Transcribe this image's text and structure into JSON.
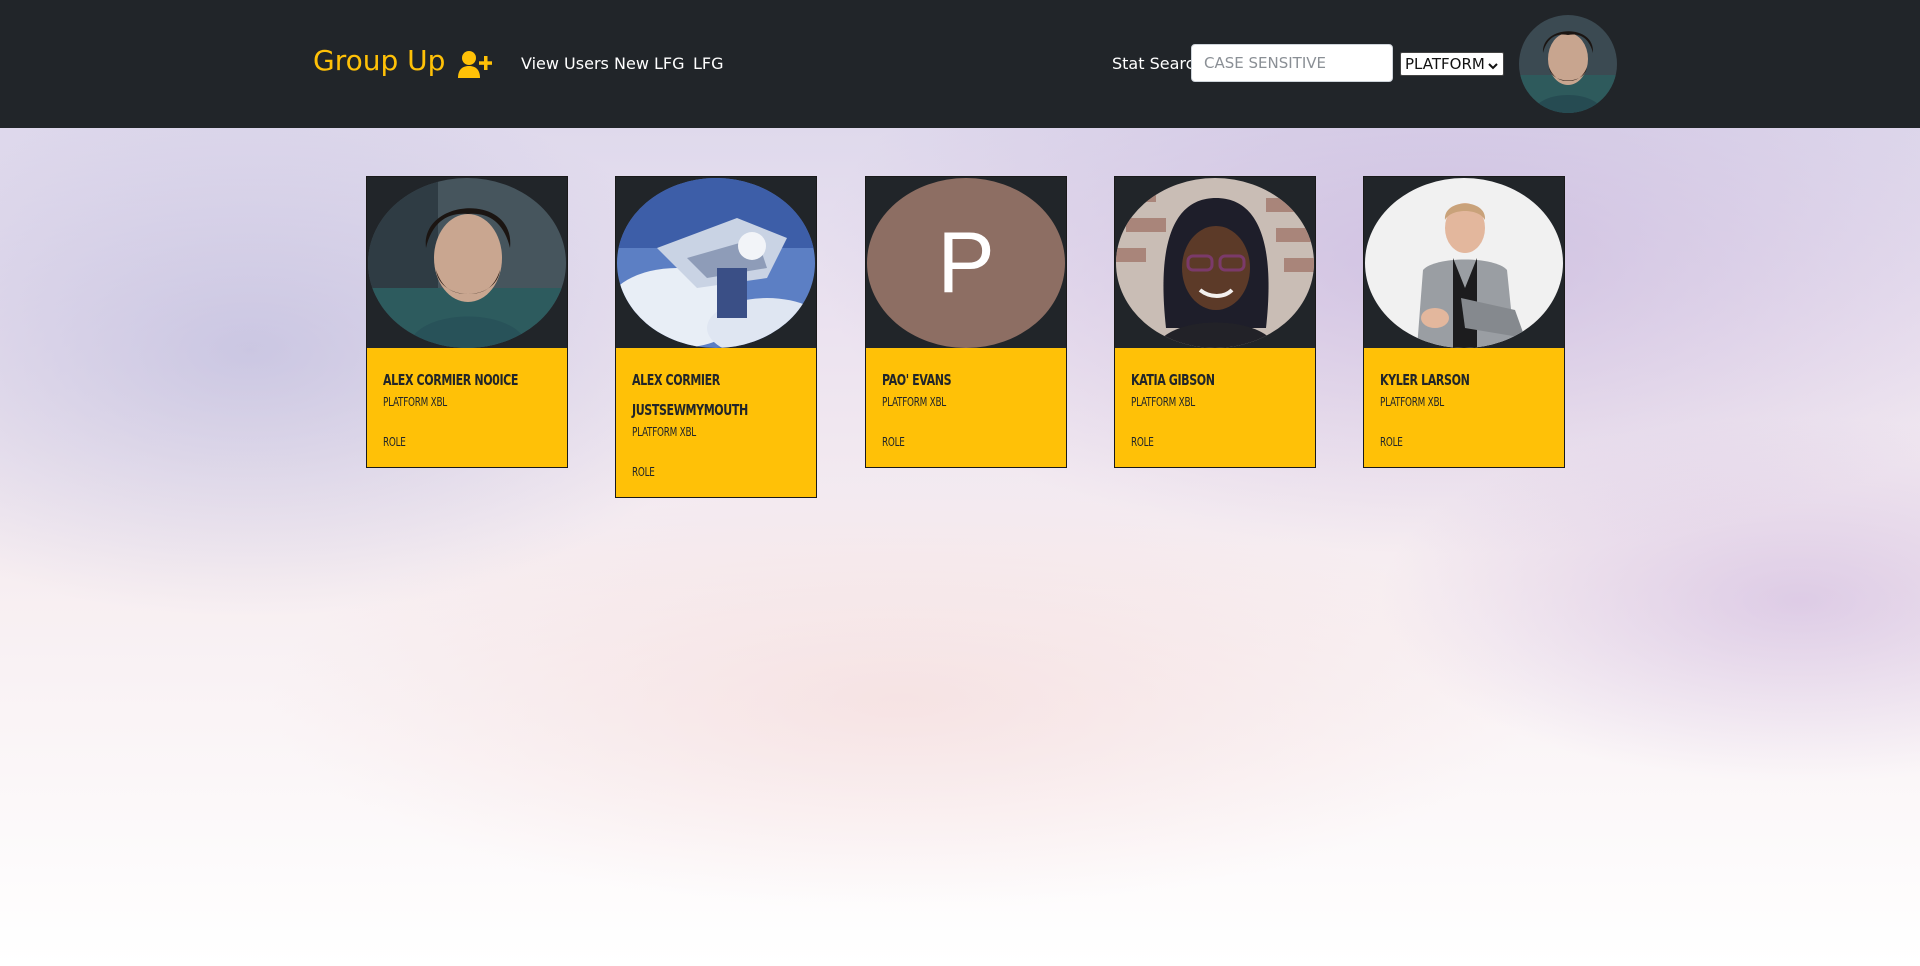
{
  "header": {
    "brand": "Group Up",
    "nav": {
      "view_users": "View Users",
      "new_lfg": "New LFG",
      "lfg": "LFG"
    },
    "stat_search_label": "Stat Search",
    "stat_search_placeholder": "CASE SENSITIVE",
    "stat_search_value": "",
    "platform_select": "PLATFORM",
    "accent_color": "#ffc107",
    "background_color": "#212529",
    "icons": {
      "add_user": "user-plus-icon",
      "dropdown": "chevron-down-icon"
    }
  },
  "users": [
    {
      "name": "Alex Cormier no0ice",
      "platform": "Platform XBL",
      "role": "Role",
      "avatar": "photo"
    },
    {
      "name": "Alex Cormier JustSewMyMouth",
      "platform": "Platform XBL",
      "role": "Role",
      "avatar": "photo"
    },
    {
      "name": "Pao' Evans",
      "platform": "Platform XBL",
      "role": "Role",
      "avatar": "initial",
      "initial": "P",
      "avatar_color": "#8d6e63"
    },
    {
      "name": "Katia Gibson",
      "platform": "Platform XBL",
      "role": "Role",
      "avatar": "photo"
    },
    {
      "name": "Kyler Larson",
      "platform": "Platform XBL",
      "role": "Role",
      "avatar": "photo"
    }
  ],
  "card_color": "#ffc107"
}
